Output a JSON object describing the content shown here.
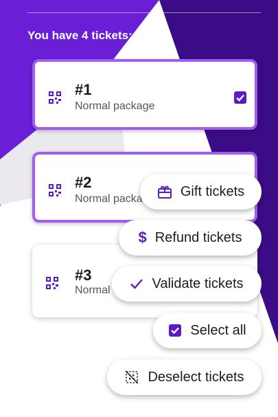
{
  "header": {
    "title": "You have 4 tickets:"
  },
  "tickets": [
    {
      "number": "#1",
      "package": "Normal package",
      "selected": true
    },
    {
      "number": "#2",
      "package": "Normal packa",
      "selected": true
    },
    {
      "number": "#3",
      "package": "Normal",
      "selected": false
    }
  ],
  "actions": {
    "gift": "Gift tickets",
    "refund": "Refund tickets",
    "validate": "Validate tickets",
    "select_all": "Select all",
    "deselect": "Deselect tickets"
  },
  "colors": {
    "accent": "#5e19c7",
    "dark_purple": "#3a0d86",
    "card_border": "#a35cf2"
  },
  "icons": {
    "qr": "qr-code-icon",
    "check": "checkbox-checked-icon",
    "gift": "gift-icon",
    "dollar": "dollar-icon",
    "checkmark": "checkmark-icon",
    "deselect": "deselect-icon"
  }
}
